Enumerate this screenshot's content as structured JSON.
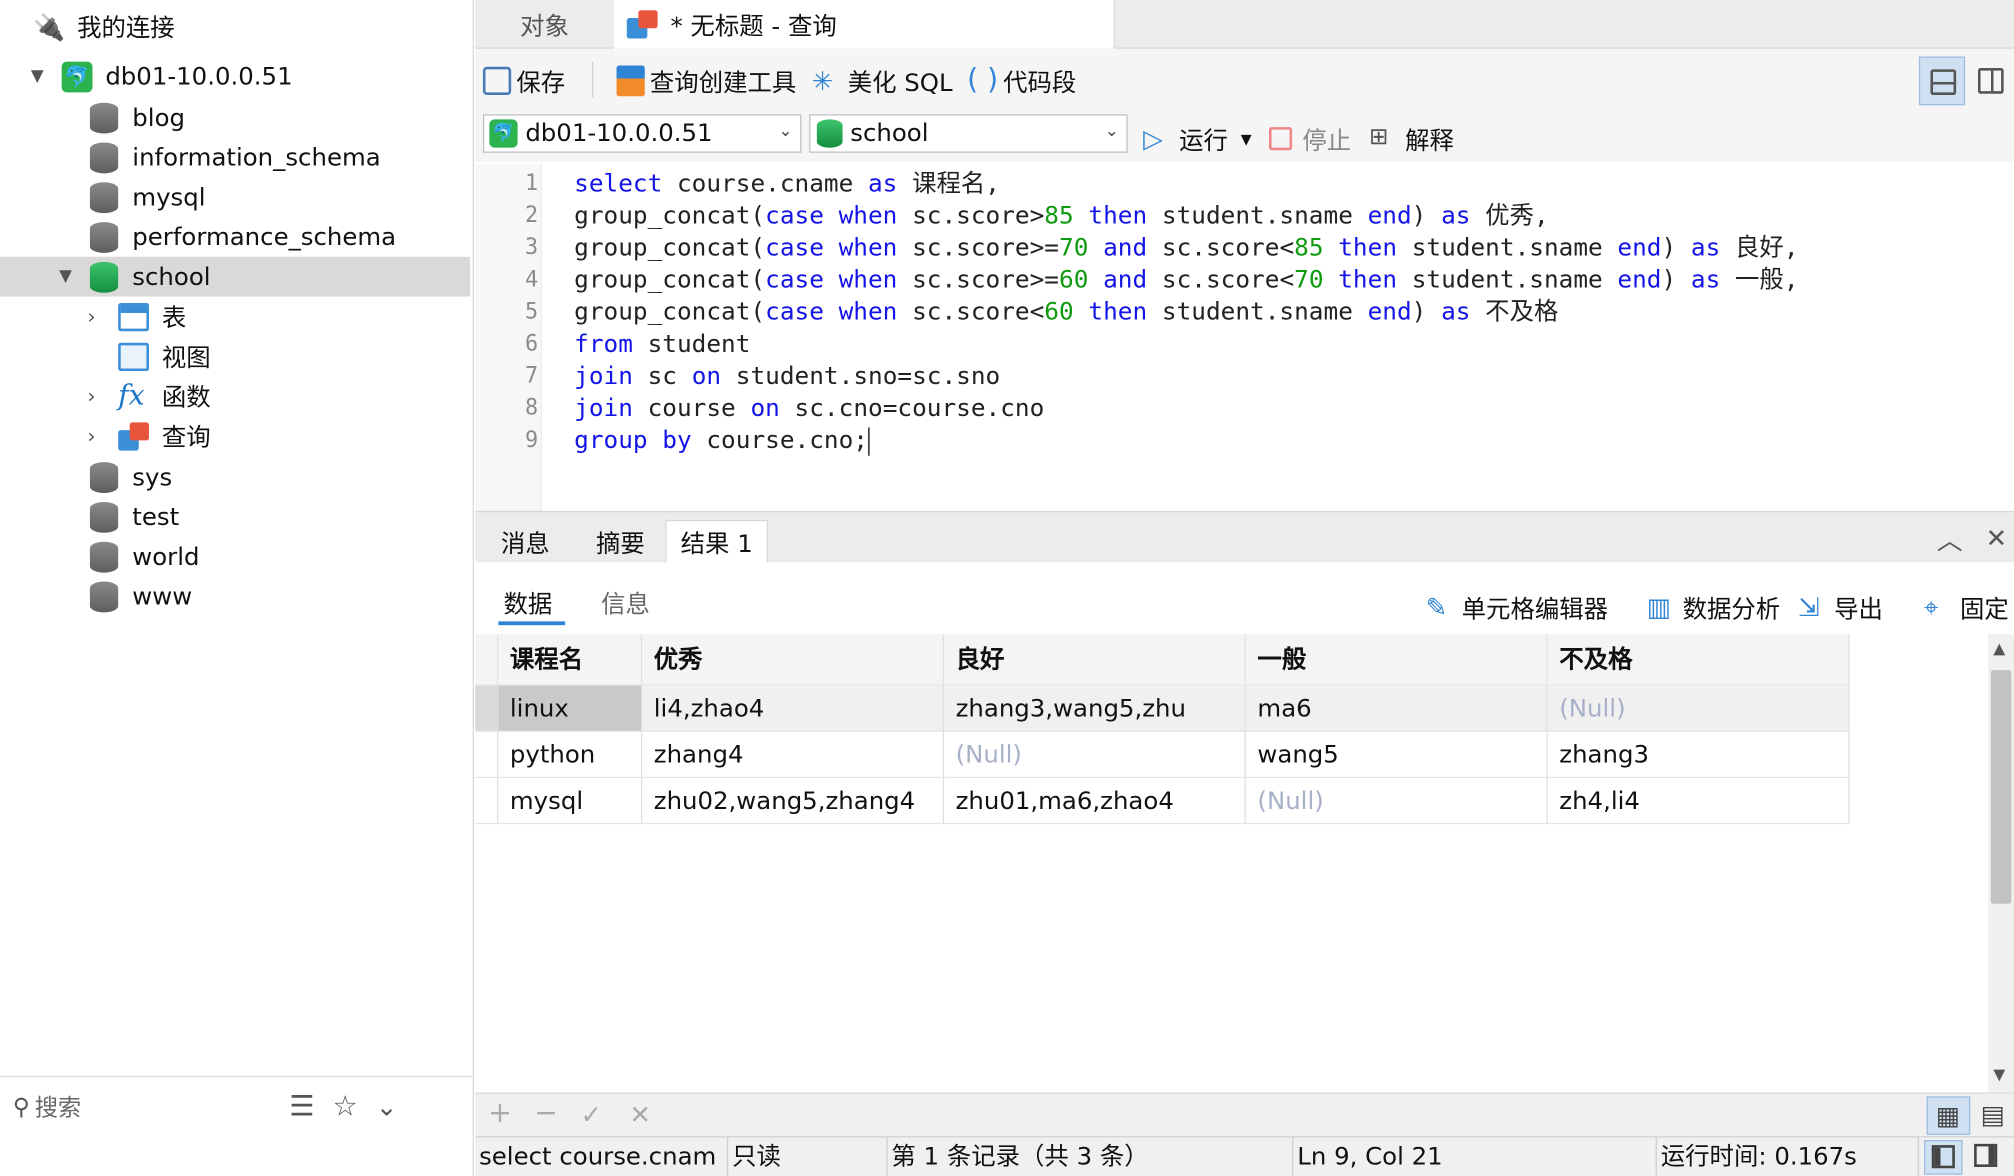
{
  "sidebar": {
    "header": "我的连接",
    "connection": "db01-10.0.0.51",
    "databases": [
      "blog",
      "information_schema",
      "mysql",
      "performance_schema"
    ],
    "selected_db": "school",
    "school_children": [
      "表",
      "视图",
      "函数",
      "查询"
    ],
    "databases_after": [
      "sys",
      "test",
      "world",
      "www"
    ],
    "search_placeholder": "搜索"
  },
  "tabs": {
    "objects": "对象",
    "query": "* 无标题 - 查询"
  },
  "toolbar": {
    "save": "保存",
    "query_builder": "查询创建工具",
    "beautify": "美化 SQL",
    "snippet": "代码段",
    "connection_select": "db01-10.0.0.51",
    "database_select": "school",
    "run": "运行",
    "stop": "停止",
    "explain": "解释"
  },
  "editor": {
    "line_numbers": [
      "1",
      "2",
      "3",
      "4",
      "5",
      "6",
      "7",
      "8",
      "9"
    ]
  },
  "result_tabs": {
    "messages": "消息",
    "summary": "摘要",
    "result1": "结果 1"
  },
  "data_toolbar": {
    "data_tab": "数据",
    "info_tab": "信息",
    "cell_editor": "单元格编辑器",
    "data_analysis": "数据分析",
    "export": "导出",
    "pin": "固定"
  },
  "grid": {
    "columns": [
      "课程名",
      "优秀",
      "良好",
      "一般",
      "不及格"
    ],
    "rows": [
      [
        "linux",
        "li4,zhao4",
        "zhang3,wang5,zhu",
        "ma6",
        "(Null)"
      ],
      [
        "python",
        "zhang4",
        "(Null)",
        "wang5",
        "zhang3"
      ],
      [
        "mysql",
        "zhu02,wang5,zhang4",
        "zhu01,ma6,zhao4",
        "(Null)",
        "zh4,li4"
      ]
    ]
  },
  "status": {
    "query_preview": "select course.cnam",
    "readonly": "只读",
    "record": "第 1 条记录（共 3 条）",
    "position": "Ln 9, Col 21",
    "runtime": "运行时间: 0.167s"
  },
  "colors": {
    "accent": "#1414e6",
    "number": "#109a10",
    "null": "#a8b0c8",
    "connection_green": "#2cb34f"
  }
}
